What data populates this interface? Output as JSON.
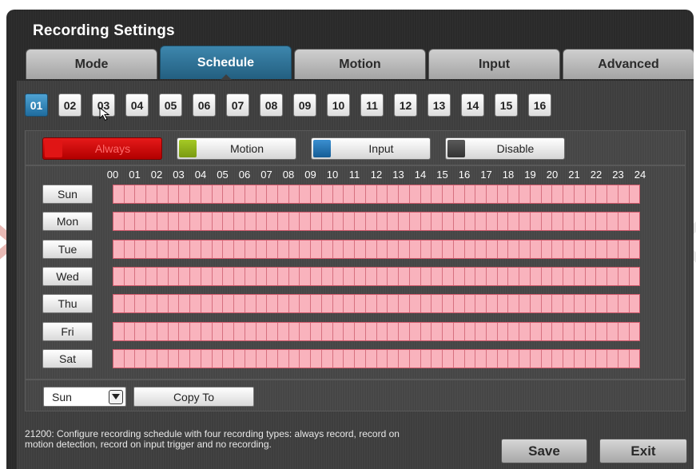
{
  "window": {
    "title": "Recording Settings"
  },
  "tabs": [
    {
      "label": "Mode",
      "active": false
    },
    {
      "label": "Schedule",
      "active": true
    },
    {
      "label": "Motion",
      "active": false
    },
    {
      "label": "Input",
      "active": false
    },
    {
      "label": "Advanced",
      "active": false
    }
  ],
  "channels": {
    "items": [
      "01",
      "02",
      "03",
      "04",
      "05",
      "06",
      "07",
      "08",
      "09",
      "10",
      "11",
      "12",
      "13",
      "14",
      "15",
      "16"
    ],
    "selected": "01"
  },
  "recording_types": [
    {
      "label": "Always",
      "color": "#e01515",
      "selected": true
    },
    {
      "label": "Motion",
      "color": "#8fb21a",
      "selected": false
    },
    {
      "label": "Input",
      "color": "#1e73b8",
      "selected": false
    },
    {
      "label": "Disable",
      "color": "#4a4a4a",
      "selected": false
    }
  ],
  "schedule": {
    "hours": [
      "00",
      "01",
      "02",
      "03",
      "04",
      "05",
      "06",
      "07",
      "08",
      "09",
      "10",
      "11",
      "12",
      "13",
      "14",
      "15",
      "16",
      "17",
      "18",
      "19",
      "20",
      "21",
      "22",
      "23",
      "24"
    ],
    "days": [
      "Sun",
      "Mon",
      "Tue",
      "Wed",
      "Thu",
      "Fri",
      "Sat"
    ],
    "slots_per_day": 48,
    "slot_color": "#f9b3bd"
  },
  "copy": {
    "day_value": "Sun",
    "copy_label": "Copy To"
  },
  "footer": {
    "message": "21200: Configure recording schedule with four recording types: always record, record on motion detection, record on input trigger and no recording.",
    "save_label": "Save",
    "exit_label": "Exit"
  },
  "icons": {
    "dropdown": "chevron-down-icon",
    "cursor": "mouse-pointer-icon"
  }
}
